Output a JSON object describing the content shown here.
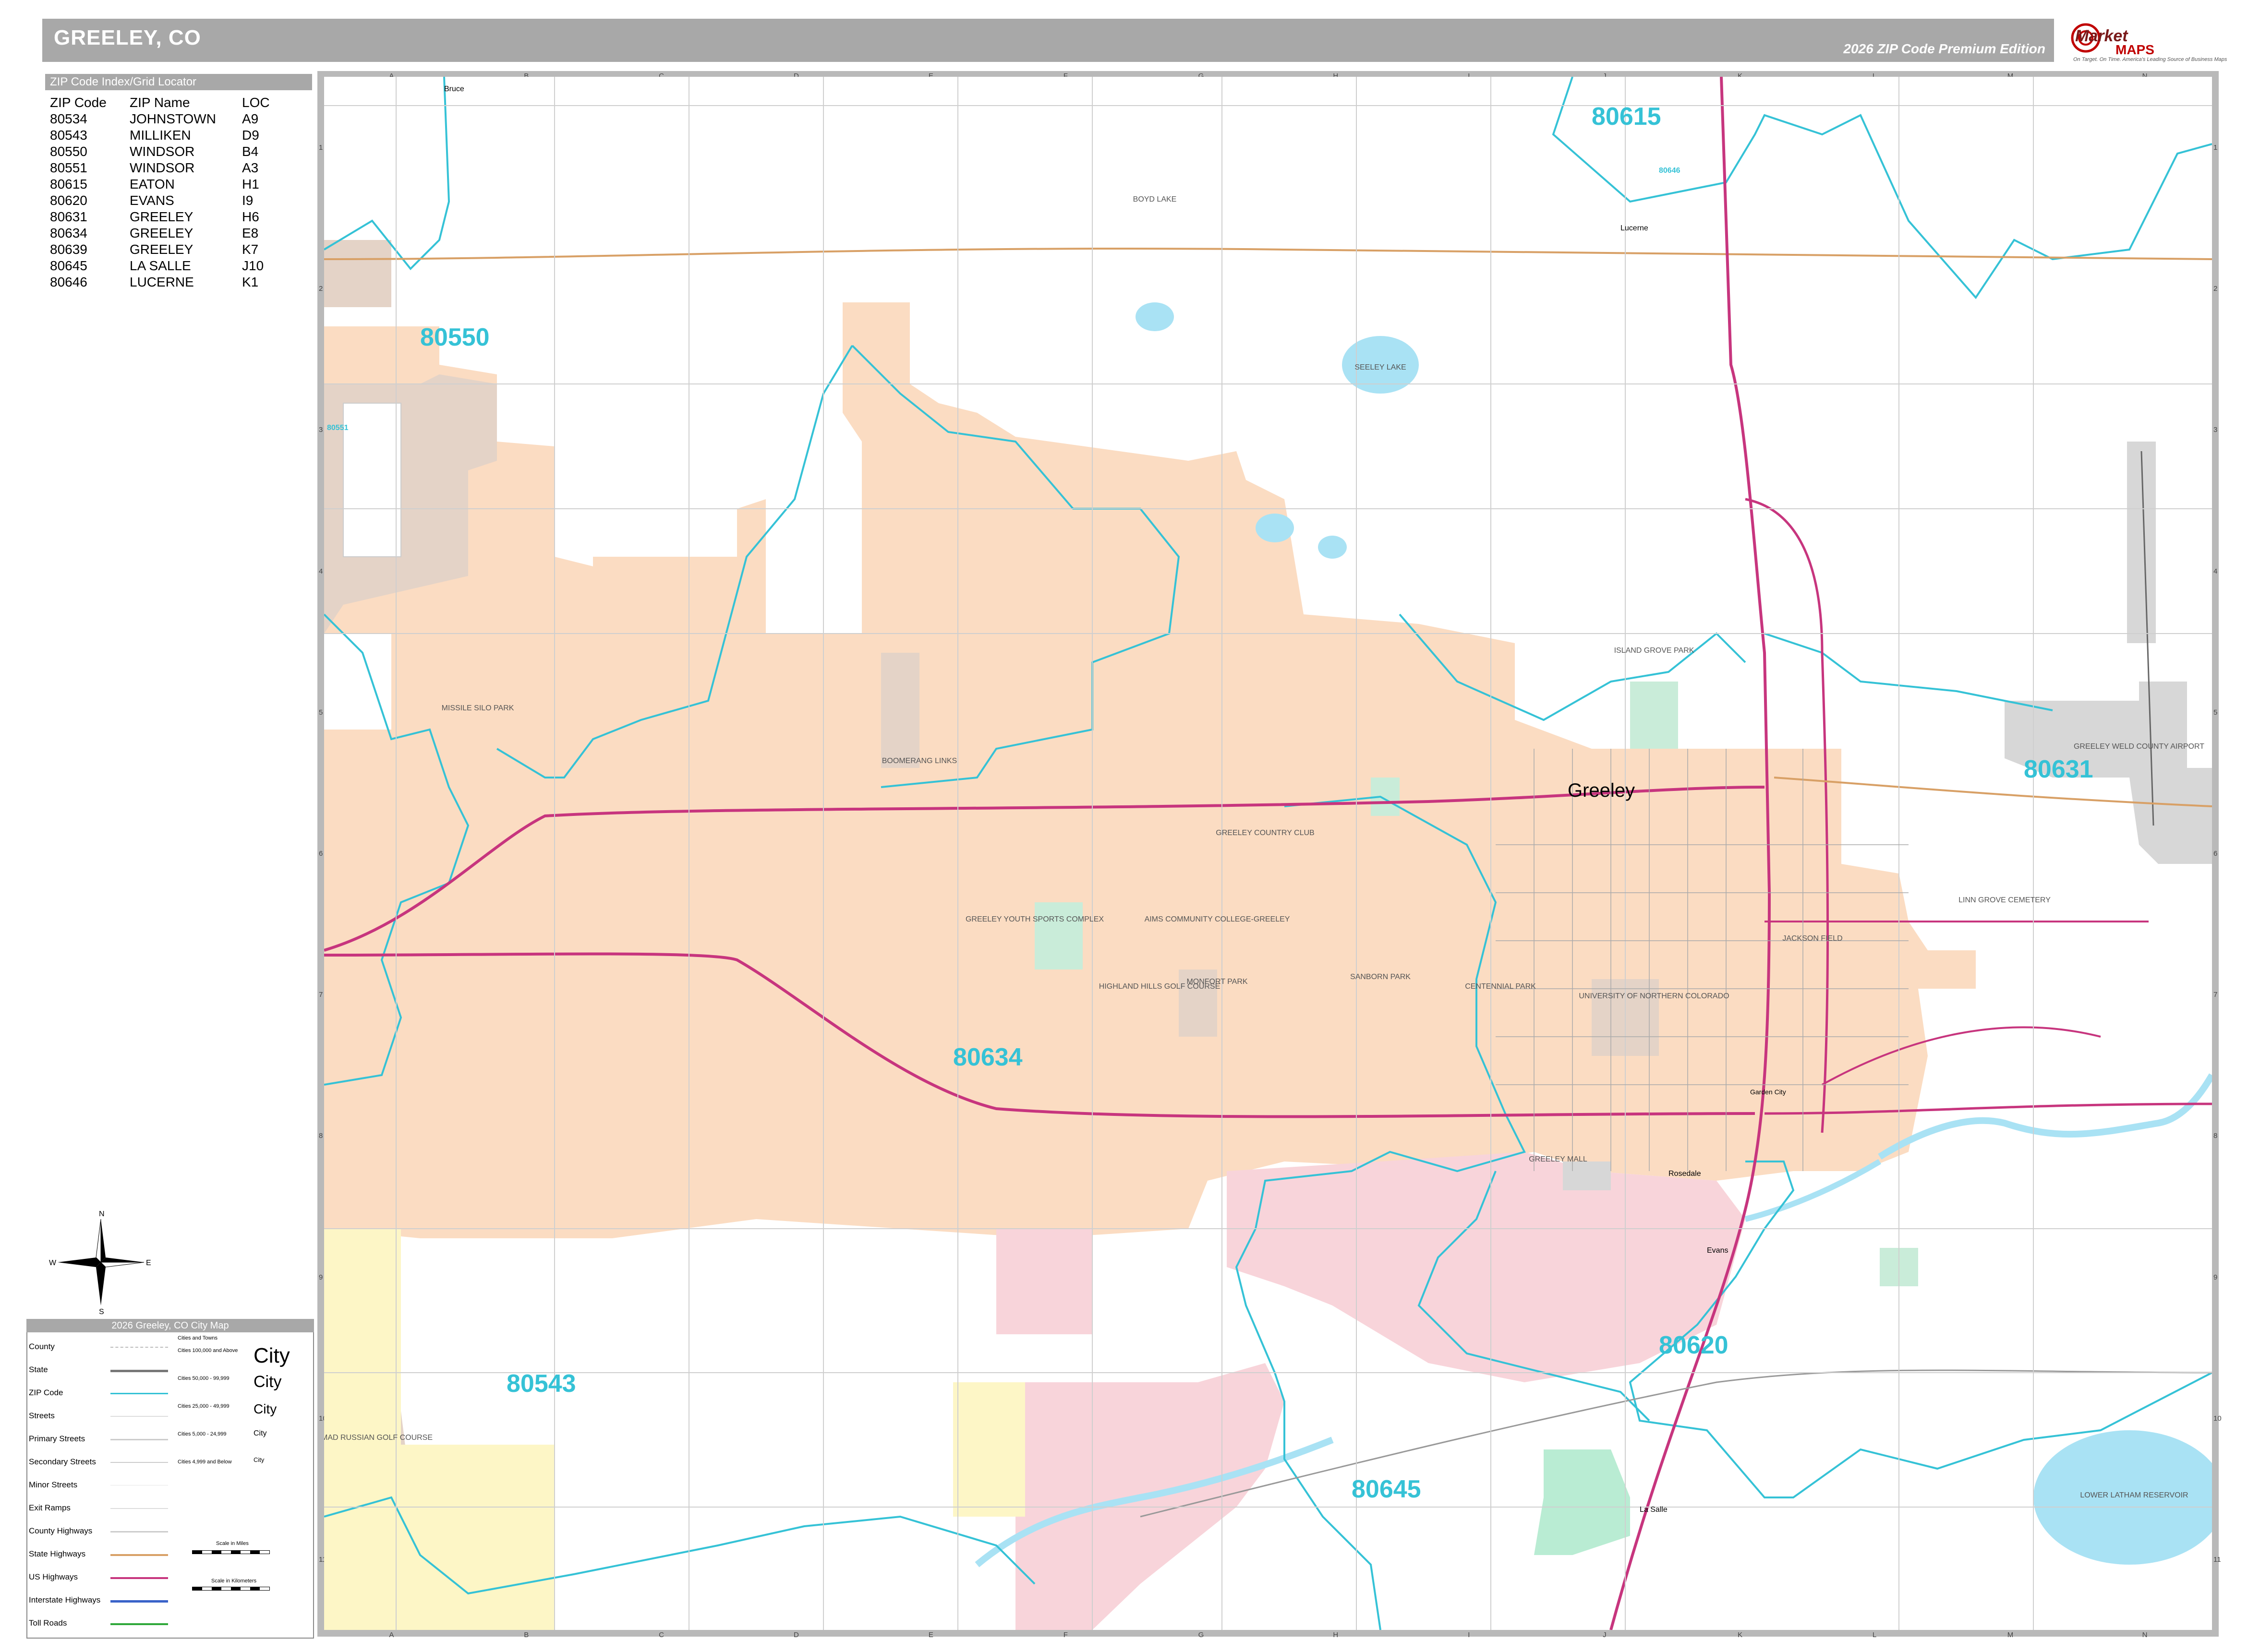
{
  "header": {
    "title": "GREELEY, CO",
    "edition": "2026 ZIP Code Premium Edition",
    "logo_word": "Market",
    "logo_word2": "MAPS",
    "logo_tagline": "On Target. On Time.",
    "logo_tagline2": "America's Leading Source of Business Maps"
  },
  "zip_index": {
    "header": "ZIP Code Index/Grid Locator",
    "columns": [
      "ZIP Code",
      "ZIP Name",
      "LOC"
    ],
    "rows": [
      [
        "80534",
        "JOHNSTOWN",
        "A9"
      ],
      [
        "80543",
        "MILLIKEN",
        "D9"
      ],
      [
        "80550",
        "WINDSOR",
        "B4"
      ],
      [
        "80551",
        "WINDSOR",
        "A3"
      ],
      [
        "80615",
        "EATON",
        "H1"
      ],
      [
        "80620",
        "EVANS",
        "I9"
      ],
      [
        "80631",
        "GREELEY",
        "H6"
      ],
      [
        "80634",
        "GREELEY",
        "E8"
      ],
      [
        "80639",
        "GREELEY",
        "K7"
      ],
      [
        "80645",
        "LA SALLE",
        "J10"
      ],
      [
        "80646",
        "LUCERNE",
        "K1"
      ]
    ]
  },
  "grid": {
    "columns": [
      "A",
      "B",
      "C",
      "D",
      "E",
      "F",
      "G",
      "H",
      "I",
      "J",
      "K",
      "L",
      "M",
      "N"
    ],
    "rows": [
      "1",
      "2",
      "3",
      "4",
      "5",
      "6",
      "7",
      "8",
      "9",
      "10",
      "11"
    ]
  },
  "compass": {
    "n": "N",
    "s": "S",
    "e": "E",
    "w": "W"
  },
  "map": {
    "zip_labels": [
      {
        "id": "80615",
        "text": "80615"
      },
      {
        "id": "80646",
        "text": "80646"
      },
      {
        "id": "80550",
        "text": "80550"
      },
      {
        "id": "80551",
        "text": "80551"
      },
      {
        "id": "80631",
        "text": "80631"
      },
      {
        "id": "80634",
        "text": "80634"
      },
      {
        "id": "80620",
        "text": "80620"
      },
      {
        "id": "80543",
        "text": "80543"
      },
      {
        "id": "80645",
        "text": "80645"
      }
    ],
    "city_labels": {
      "greeley": "Greeley",
      "lucerne": "Lucerne",
      "bruce": "Bruce",
      "rosedale": "Rosedale",
      "evans": "Evans",
      "la_salle": "La Salle",
      "garden_city": "Garden City"
    },
    "place_labels": {
      "boomerang": "BOOMERANG LINKS",
      "greeley_cc": "GREELEY COUNTRY CLUB",
      "aims": "AIMS COMMUNITY COLLEGE-GREELEY",
      "youth": "GREELEY YOUTH SPORTS COMPLEX",
      "highland": "HIGHLAND HILLS GOLF COURSE",
      "unc": "UNIVERSITY OF NORTHERN COLORADO",
      "island_grove": "ISLAND GROVE PARK",
      "greeley_mall": "GREELEY MALL",
      "airport": "GREELEY WELD COUNTY AIRPORT",
      "linn_grove": "LINN GROVE CEMETERY",
      "sanborn": "SANBORN PARK",
      "centennial": "CENTENNIAL PARK",
      "missile": "MISSILE SILO PARK",
      "mad_russian": "MAD RUSSIAN GOLF COURSE",
      "seeley_lake": "SEELEY LAKE",
      "lower_latham": "LOWER LATHAM RESERVOIR",
      "boyd_lake": "BOYD LAKE",
      "jackson_field": "JACKSON FIELD",
      "monfort": "MONFORT PARK"
    }
  },
  "legend": {
    "title": "2026 Greeley, CO City Map",
    "items": [
      "County",
      "State",
      "ZIP Code",
      "Streets",
      "Primary Streets",
      "Secondary Streets",
      "Minor Streets",
      "Exit Ramps",
      "County Highways",
      "State Highways",
      "US Highways",
      "Interstate Highways",
      "Toll Roads"
    ],
    "city_classes": [
      "Cities and Towns",
      "Cities 100,000 and Above",
      "Cities 50,000 - 99,999",
      "Cities 25,000 - 49,999",
      "Cities 5,000 - 24,999",
      "Cities 4,999 and Below"
    ],
    "city_samples": [
      "City",
      "City",
      "City",
      "City",
      "City"
    ],
    "scale_miles": "Scale in Miles",
    "scale_km": "Scale in Kilometers"
  },
  "colors": {
    "zip_boundary": "#35c2d6",
    "zip_label": "#35c2d6",
    "us_highway": "#c7357e",
    "interstate": "#c7357e",
    "state_highway": "#d8a066",
    "greeley_fill": "#fbdcc2",
    "windsor_fill": "#e4d3c7",
    "evans_fill": "#f8d4da",
    "lasalle_fill": "#b9ecd3",
    "milliken_fill": "#fdf6c6",
    "water": "#a9e2f4",
    "airport_fill": "#d7d7d7",
    "park_fill": "#c9ecd9"
  }
}
